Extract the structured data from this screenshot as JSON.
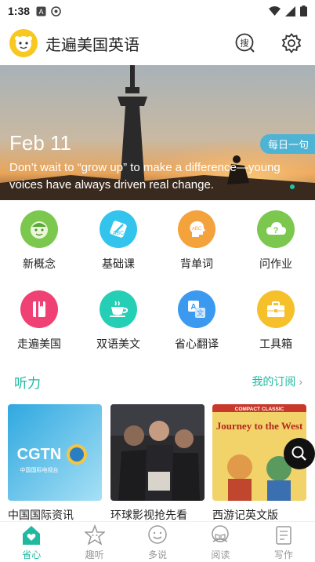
{
  "status": {
    "time": "1:38"
  },
  "header": {
    "title": "走遍美国英语",
    "search_label": "搜"
  },
  "banner": {
    "date": "Feb 11",
    "badge": "每日一句",
    "quote": "Don’t wait to “grow up” to make a difference—young voices have always driven real change."
  },
  "grid": [
    {
      "label": "新概念",
      "icon": "face-icon",
      "color": "#7cc84f"
    },
    {
      "label": "基础课",
      "icon": "brush-icon",
      "color": "#33c4ee"
    },
    {
      "label": "背单词",
      "icon": "head-icon",
      "color": "#f4a23c"
    },
    {
      "label": "问作业",
      "icon": "cloud-question-icon",
      "color": "#7cc84f"
    },
    {
      "label": "走遍美国",
      "icon": "book-icon",
      "color": "#ef4173"
    },
    {
      "label": "双语美文",
      "icon": "cup-icon",
      "color": "#25cfb6"
    },
    {
      "label": "省心翻译",
      "icon": "translate-icon",
      "color": "#3b9af0"
    },
    {
      "label": "工具箱",
      "icon": "toolbox-icon",
      "color": "#f6c02a"
    }
  ],
  "section": {
    "title": "听力",
    "link": "我的订阅"
  },
  "cards": [
    {
      "title": "中国国际资讯",
      "thumb_text": "CGTN",
      "thumb_sub": "中国国际电视台"
    },
    {
      "title": "环球影视抢先看",
      "thumb_text": ""
    },
    {
      "title": "西游记英文版",
      "thumb_text": "Journey to the West",
      "thumb_sub": "COMPACT CLASSIC"
    }
  ],
  "tabs": [
    {
      "label": "省心",
      "icon": "home-heart-icon",
      "active": true
    },
    {
      "label": "趣听",
      "icon": "star-face-icon",
      "active": false
    },
    {
      "label": "多说",
      "icon": "smile-bubble-icon",
      "active": false
    },
    {
      "label": "阅读",
      "icon": "open-book-icon",
      "active": false
    },
    {
      "label": "写作",
      "icon": "note-icon",
      "active": false
    }
  ]
}
